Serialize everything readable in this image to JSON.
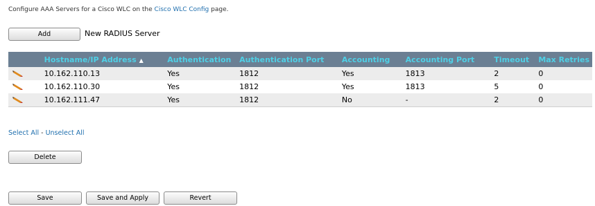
{
  "intro": {
    "prefix": "Configure AAA Servers for a Cisco WLC on the ",
    "link": "Cisco WLC Config",
    "suffix": " page."
  },
  "add_button": "Add",
  "add_label": "New RADIUS Server",
  "table": {
    "columns": [
      "Hostname/IP Address",
      "Authentication",
      "Authentication Port",
      "Accounting",
      "Accounting Port",
      "Timeout",
      "Max Retries"
    ],
    "sorted_column": "Hostname/IP Address",
    "sort_direction": "ascending",
    "rows": [
      {
        "host": "10.162.110.13",
        "auth": "Yes",
        "auth_port": "1812",
        "acct": "Yes",
        "acct_port": "1813",
        "timeout": "2",
        "retries": "0"
      },
      {
        "host": "10.162.110.30",
        "auth": "Yes",
        "auth_port": "1812",
        "acct": "Yes",
        "acct_port": "1813",
        "timeout": "5",
        "retries": "0"
      },
      {
        "host": "10.162.111.47",
        "auth": "Yes",
        "auth_port": "1812",
        "acct": "No",
        "acct_port": "-",
        "timeout": "2",
        "retries": "0"
      }
    ]
  },
  "select_all": "Select All",
  "select_sep": " - ",
  "unselect_all": "Unselect All",
  "delete_button": "Delete",
  "save_button": "Save",
  "save_apply_button": "Save and Apply",
  "revert_button": "Revert",
  "icons": {
    "row_edit": "pencil-icon",
    "sort": "sort-ascending-icon"
  },
  "colors": {
    "header_bg": "#6b7f93",
    "header_text": "#4fd0e6",
    "link": "#1f6fae",
    "row_alt": "#ececec"
  }
}
